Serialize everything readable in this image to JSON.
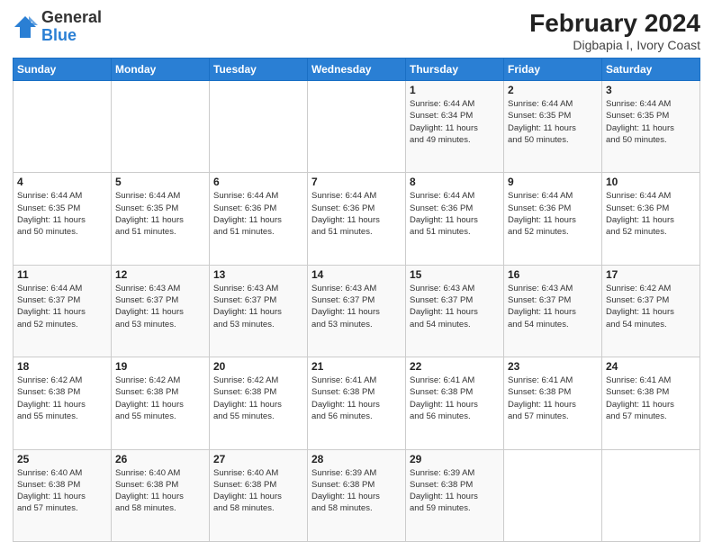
{
  "header": {
    "logo_general": "General",
    "logo_blue": "Blue",
    "month_year": "February 2024",
    "location": "Digbapia I, Ivory Coast"
  },
  "weekdays": [
    "Sunday",
    "Monday",
    "Tuesday",
    "Wednesday",
    "Thursday",
    "Friday",
    "Saturday"
  ],
  "weeks": [
    [
      {
        "day": "",
        "info": ""
      },
      {
        "day": "",
        "info": ""
      },
      {
        "day": "",
        "info": ""
      },
      {
        "day": "",
        "info": ""
      },
      {
        "day": "1",
        "info": "Sunrise: 6:44 AM\nSunset: 6:34 PM\nDaylight: 11 hours\nand 49 minutes."
      },
      {
        "day": "2",
        "info": "Sunrise: 6:44 AM\nSunset: 6:35 PM\nDaylight: 11 hours\nand 50 minutes."
      },
      {
        "day": "3",
        "info": "Sunrise: 6:44 AM\nSunset: 6:35 PM\nDaylight: 11 hours\nand 50 minutes."
      }
    ],
    [
      {
        "day": "4",
        "info": "Sunrise: 6:44 AM\nSunset: 6:35 PM\nDaylight: 11 hours\nand 50 minutes."
      },
      {
        "day": "5",
        "info": "Sunrise: 6:44 AM\nSunset: 6:35 PM\nDaylight: 11 hours\nand 51 minutes."
      },
      {
        "day": "6",
        "info": "Sunrise: 6:44 AM\nSunset: 6:36 PM\nDaylight: 11 hours\nand 51 minutes."
      },
      {
        "day": "7",
        "info": "Sunrise: 6:44 AM\nSunset: 6:36 PM\nDaylight: 11 hours\nand 51 minutes."
      },
      {
        "day": "8",
        "info": "Sunrise: 6:44 AM\nSunset: 6:36 PM\nDaylight: 11 hours\nand 51 minutes."
      },
      {
        "day": "9",
        "info": "Sunrise: 6:44 AM\nSunset: 6:36 PM\nDaylight: 11 hours\nand 52 minutes."
      },
      {
        "day": "10",
        "info": "Sunrise: 6:44 AM\nSunset: 6:36 PM\nDaylight: 11 hours\nand 52 minutes."
      }
    ],
    [
      {
        "day": "11",
        "info": "Sunrise: 6:44 AM\nSunset: 6:37 PM\nDaylight: 11 hours\nand 52 minutes."
      },
      {
        "day": "12",
        "info": "Sunrise: 6:43 AM\nSunset: 6:37 PM\nDaylight: 11 hours\nand 53 minutes."
      },
      {
        "day": "13",
        "info": "Sunrise: 6:43 AM\nSunset: 6:37 PM\nDaylight: 11 hours\nand 53 minutes."
      },
      {
        "day": "14",
        "info": "Sunrise: 6:43 AM\nSunset: 6:37 PM\nDaylight: 11 hours\nand 53 minutes."
      },
      {
        "day": "15",
        "info": "Sunrise: 6:43 AM\nSunset: 6:37 PM\nDaylight: 11 hours\nand 54 minutes."
      },
      {
        "day": "16",
        "info": "Sunrise: 6:43 AM\nSunset: 6:37 PM\nDaylight: 11 hours\nand 54 minutes."
      },
      {
        "day": "17",
        "info": "Sunrise: 6:42 AM\nSunset: 6:37 PM\nDaylight: 11 hours\nand 54 minutes."
      }
    ],
    [
      {
        "day": "18",
        "info": "Sunrise: 6:42 AM\nSunset: 6:38 PM\nDaylight: 11 hours\nand 55 minutes."
      },
      {
        "day": "19",
        "info": "Sunrise: 6:42 AM\nSunset: 6:38 PM\nDaylight: 11 hours\nand 55 minutes."
      },
      {
        "day": "20",
        "info": "Sunrise: 6:42 AM\nSunset: 6:38 PM\nDaylight: 11 hours\nand 55 minutes."
      },
      {
        "day": "21",
        "info": "Sunrise: 6:41 AM\nSunset: 6:38 PM\nDaylight: 11 hours\nand 56 minutes."
      },
      {
        "day": "22",
        "info": "Sunrise: 6:41 AM\nSunset: 6:38 PM\nDaylight: 11 hours\nand 56 minutes."
      },
      {
        "day": "23",
        "info": "Sunrise: 6:41 AM\nSunset: 6:38 PM\nDaylight: 11 hours\nand 57 minutes."
      },
      {
        "day": "24",
        "info": "Sunrise: 6:41 AM\nSunset: 6:38 PM\nDaylight: 11 hours\nand 57 minutes."
      }
    ],
    [
      {
        "day": "25",
        "info": "Sunrise: 6:40 AM\nSunset: 6:38 PM\nDaylight: 11 hours\nand 57 minutes."
      },
      {
        "day": "26",
        "info": "Sunrise: 6:40 AM\nSunset: 6:38 PM\nDaylight: 11 hours\nand 58 minutes."
      },
      {
        "day": "27",
        "info": "Sunrise: 6:40 AM\nSunset: 6:38 PM\nDaylight: 11 hours\nand 58 minutes."
      },
      {
        "day": "28",
        "info": "Sunrise: 6:39 AM\nSunset: 6:38 PM\nDaylight: 11 hours\nand 58 minutes."
      },
      {
        "day": "29",
        "info": "Sunrise: 6:39 AM\nSunset: 6:38 PM\nDaylight: 11 hours\nand 59 minutes."
      },
      {
        "day": "",
        "info": ""
      },
      {
        "day": "",
        "info": ""
      }
    ]
  ]
}
